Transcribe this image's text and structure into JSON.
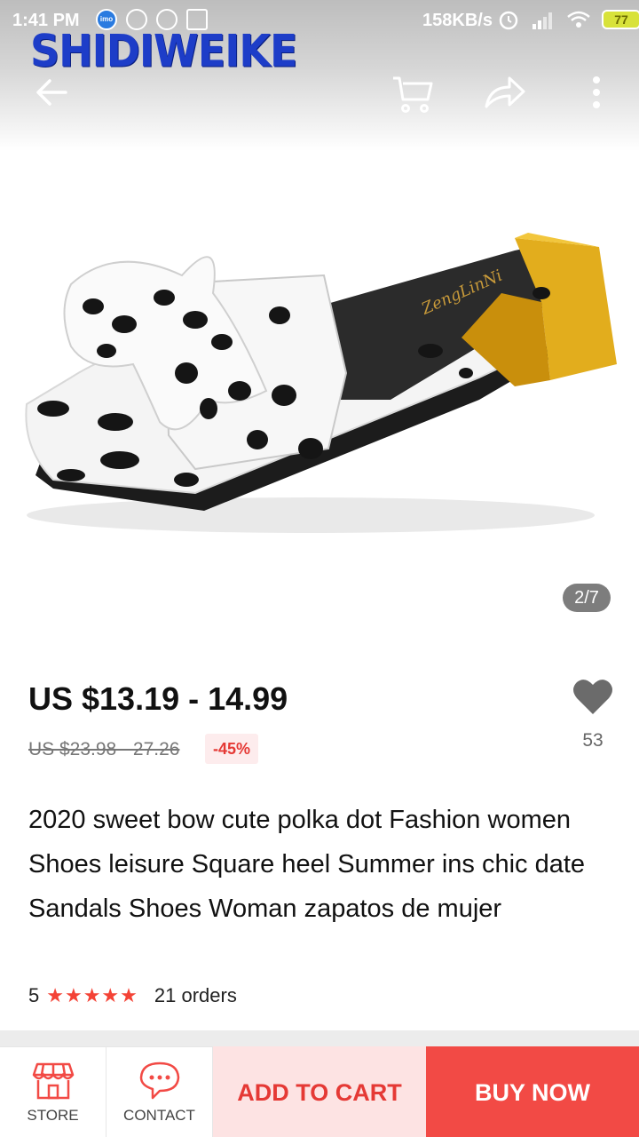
{
  "status_bar": {
    "time": "1:41 PM",
    "imo_label": "imo",
    "net_speed": "158KB/s",
    "battery": "77"
  },
  "watermark": "SHIDIWEIKE",
  "gallery": {
    "indicator": "2/7",
    "insole_brand": "ZengLinNi"
  },
  "product": {
    "price": "US $13.19 - 14.99",
    "original_price": "US $23.98 - 27.26",
    "discount": "-45%",
    "wishlist_count": "53",
    "title": "2020 sweet bow cute polka dot Fashion women Shoes leisure Square heel Summer ins chic date Sandals Shoes Woman zapatos de mujer",
    "rating": "5",
    "stars": "★★★★★",
    "orders": "21 orders"
  },
  "bottom_bar": {
    "store_label": "STORE",
    "contact_label": "CONTACT",
    "add_to_cart_label": "ADD TO CART",
    "buy_now_label": "BUY NOW"
  },
  "colors": {
    "accent": "#f24a45",
    "accent_light": "#fde3e3",
    "logo_blue": "#1d3dc8",
    "heel_yellow": "#e2ad1d"
  }
}
